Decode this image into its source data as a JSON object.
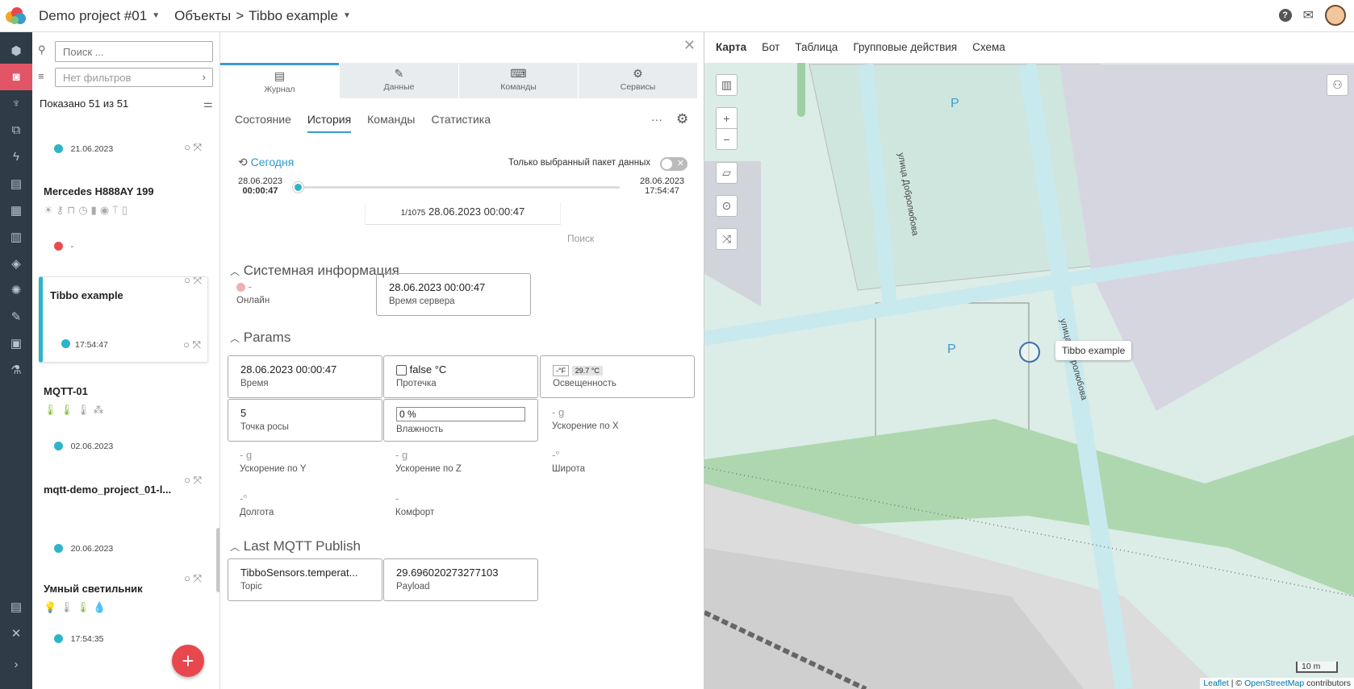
{
  "header": {
    "project": "Demo project #01",
    "section": "Объекты",
    "separator": ">",
    "object": "Tibbo example"
  },
  "list": {
    "search_placeholder": "Поиск ...",
    "filter_placeholder": "Нет фильтров",
    "shown": "Показано 51 из 51",
    "items": [
      {
        "name": "",
        "status_color": "#2cb5c9",
        "time": "21.06.2023"
      },
      {
        "name": "Mercedes H888AY 199",
        "status_color": "#e74c4c",
        "time": "-"
      },
      {
        "name": "Tibbo example",
        "status_color": "#2cb5c9",
        "time": "17:54:47"
      },
      {
        "name": "MQTT-01",
        "status_color": "#2cb5c9",
        "time": "02.06.2023"
      },
      {
        "name": "mqtt-demo_project_01-l...",
        "status_color": "#2cb5c9",
        "time": "20.06.2023"
      },
      {
        "name": "Умный светильник",
        "status_color": "#2cb5c9",
        "time": "17:54:35"
      }
    ]
  },
  "panel": {
    "tabs": [
      "Журнал",
      "Данные",
      "Команды",
      "Сервисы"
    ],
    "subtabs": [
      "Состояние",
      "История",
      "Команды",
      "Статистика"
    ],
    "history": {
      "label": "Сегодня",
      "only_selected": "Только выбранный пакет данных",
      "start_date": "28.06.2023",
      "start_time": "00:00:47",
      "end_date": "28.06.2023",
      "end_time": "17:54:47",
      "counter": "1/1075",
      "current": "28.06.2023 00:00:47",
      "search": "Поиск"
    },
    "sections": {
      "system": "Системная информация",
      "params": "Params",
      "mqtt": "Last MQTT Publish"
    },
    "system": {
      "online_value": "-",
      "online_label": "Онлайн",
      "server_time_value": "28.06.2023 00:00:47",
      "server_time_label": "Время сервера"
    },
    "params": {
      "time_value": "28.06.2023 00:00:47",
      "time_label": "Время",
      "leak_value": "false °C",
      "leak_label": "Протечка",
      "light_unit": "-°F",
      "light_value": "29.7 °C",
      "light_label": "Освещенность",
      "dew_value": "5",
      "dew_label": "Точка росы",
      "humidity_value": "0 %",
      "humidity_label": "Влажность",
      "accx_value": "- g",
      "accx_label": "Ускорение по X",
      "accy_value": "- g",
      "accy_label": "Ускорение по Y",
      "accz_value": "- g",
      "accz_label": "Ускорение по Z",
      "lat_value": "-°",
      "lat_label": "Широта",
      "lon_value": "-°",
      "lon_label": "Долгота",
      "comfort_value": "-",
      "comfort_label": "Комфорт"
    },
    "mqtt": {
      "topic_value": "TibboSensors.temperat...",
      "topic_label": "Topic",
      "payload_value": "29.696020273277103",
      "payload_label": "Payload"
    }
  },
  "map": {
    "tabs": [
      "Карта",
      "Бот",
      "Таблица",
      "Групповые действия",
      "Схема"
    ],
    "street1": "улица Добролюбова",
    "street2": "улица Добролюбова",
    "parking": "P",
    "tooltip": "Tibbo example",
    "scale": "10 m",
    "attrib_leaflet": "Leaflet",
    "attrib_sep": "| ©",
    "attrib_osm": "OpenStreetMap",
    "attrib_contrib": "contributors"
  }
}
